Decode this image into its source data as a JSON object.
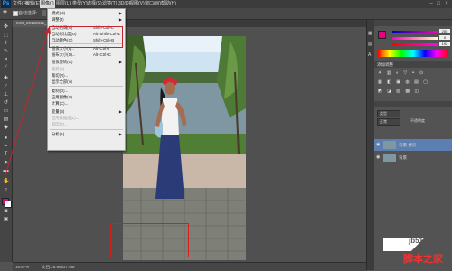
{
  "app": {
    "logo": "Ps"
  },
  "menubar": {
    "items": [
      "文件(F)",
      "编辑(E)",
      "图像(I)",
      "图层(L)",
      "类型(Y)",
      "选择(S)",
      "滤镜(T)",
      "3D(D)",
      "视图(V)",
      "窗口(W)",
      "帮助(H)"
    ],
    "active_index": 2
  },
  "options": {
    "label": "自动选择:"
  },
  "document": {
    "tab": "IMG_20150815_1...",
    "zoom": "16.67%",
    "doc_size": "文档:26.9M/27.9M"
  },
  "image_menu": {
    "items": [
      {
        "label": "模式(M)",
        "shortcut": "",
        "submenu": true,
        "disabled": false
      },
      {
        "label": "调整(J)",
        "shortcut": "",
        "submenu": true,
        "disabled": false
      },
      {
        "label": "自动色调(N)",
        "shortcut": "Shift+Ctrl+L",
        "submenu": false,
        "disabled": false
      },
      {
        "label": "自动对比度(U)",
        "shortcut": "Alt+Shift+Ctrl+L",
        "submenu": false,
        "disabled": false
      },
      {
        "label": "自动颜色(O)",
        "shortcut": "Shift+Ctrl+B",
        "submenu": false,
        "disabled": false
      },
      {
        "label": "图像大小(I)...",
        "shortcut": "Alt+Ctrl+I",
        "submenu": false,
        "disabled": false
      },
      {
        "label": "画布大小(S)...",
        "shortcut": "Alt+Ctrl+C",
        "submenu": false,
        "disabled": false
      },
      {
        "label": "图像旋转(G)",
        "shortcut": "",
        "submenu": true,
        "disabled": false
      },
      {
        "label": "裁剪(P)",
        "shortcut": "",
        "submenu": false,
        "disabled": true
      },
      {
        "label": "裁切(R)...",
        "shortcut": "",
        "submenu": false,
        "disabled": false
      },
      {
        "label": "显示全部(V)",
        "shortcut": "",
        "submenu": false,
        "disabled": false
      },
      {
        "label": "复制(D)...",
        "shortcut": "",
        "submenu": false,
        "disabled": false
      },
      {
        "label": "应用图像(Y)...",
        "shortcut": "",
        "submenu": false,
        "disabled": false
      },
      {
        "label": "计算(C)...",
        "shortcut": "",
        "submenu": false,
        "disabled": false
      },
      {
        "label": "变量(B)",
        "shortcut": "",
        "submenu": true,
        "disabled": false
      },
      {
        "label": "应用数据组(L)...",
        "shortcut": "",
        "submenu": false,
        "disabled": true
      },
      {
        "label": "陷印(T)...",
        "shortcut": "",
        "submenu": false,
        "disabled": true
      },
      {
        "label": "分析(A)",
        "shortcut": "",
        "submenu": true,
        "disabled": false
      }
    ]
  },
  "color_panel": {
    "values": [
      "255",
      "0",
      "192"
    ]
  },
  "panels": {
    "adjust_title": "添加调整",
    "layers_kind": "类型",
    "blend_mode": "正常",
    "opacity": "不透明度"
  },
  "layers": [
    {
      "name": "背景 拷贝"
    },
    {
      "name": "背景"
    }
  ],
  "watermark": {
    "site": "jb51.net",
    "name": "脚本之家"
  },
  "colors": {
    "highlight_box": "#c8232c",
    "foreground": "#e6007e",
    "selected_layer": "#5c7eb0"
  }
}
